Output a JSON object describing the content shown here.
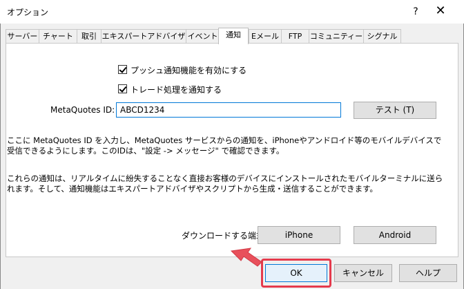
{
  "window": {
    "title": "オプション",
    "help_icon": "?",
    "close_icon": "✕"
  },
  "tabs": [
    {
      "label": "サーバー",
      "active": false
    },
    {
      "label": "チャート",
      "active": false
    },
    {
      "label": "取引",
      "active": false
    },
    {
      "label": "エキスパートアドバイザ",
      "active": false
    },
    {
      "label": "イベント",
      "active": false
    },
    {
      "label": "通知",
      "active": true
    },
    {
      "label": "Eメール",
      "active": false
    },
    {
      "label": "FTP",
      "active": false
    },
    {
      "label": "コミュニティー",
      "active": false
    },
    {
      "label": "シグナル",
      "active": false
    }
  ],
  "notifications": {
    "push_enable": {
      "label": "プッシュ通知機能を有効にする",
      "checked": true
    },
    "trade_notify": {
      "label": "トレード処理を通知する",
      "checked": true
    },
    "metaquotes_id_label": "MetaQuotes ID:",
    "metaquotes_id_value": "ABCD1234",
    "test_button": "テスト (T)",
    "info_text_1": "ここに MetaQuotes ID を入力し、MetaQuotes サービスからの通知を、iPhoneやアンドロイド等のモバイルデバイスで受信できるようにします。このIDは、\"設定 -> メッセージ\" で確認できます。",
    "info_text_2": "これらの通知は、リアルタイムに紛失することなく直接お客様のデバイスにインストールされたモバイルターミナルに送られます。そして、通知機能はエキスパートアドバイザやスクリプトから生成・送信することができます。",
    "download_label": "ダウンロードする端末:",
    "iphone_button": "iPhone",
    "android_button": "Android"
  },
  "footer": {
    "ok": "OK",
    "cancel": "キャンセル",
    "help": "ヘルプ"
  },
  "colors": {
    "highlight": "#e53a4c",
    "focus": "#0078d7"
  }
}
